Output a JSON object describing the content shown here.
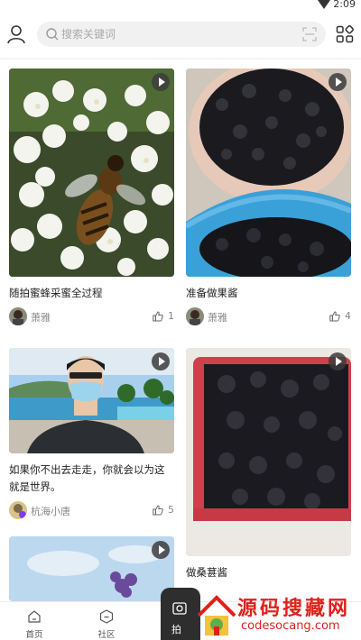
{
  "status": {
    "time": "2:09"
  },
  "header": {
    "search_placeholder": "搜索关键词",
    "user_icon": "user-icon",
    "scan_icon": "scan-icon",
    "grid_icon": "grid-icon"
  },
  "feed": {
    "cards": [
      {
        "title": "随拍蜜蜂采蜜全过程",
        "author": "萧雅",
        "likes": "1"
      },
      {
        "title": "准备做果酱",
        "author": "萧雅",
        "likes": "4"
      },
      {
        "title": "如果你不出去走走，你就会以为这就是世界。",
        "author": "杭海小唐",
        "likes": "5"
      },
      {
        "title": "做桑葚酱",
        "author": "",
        "likes": ""
      },
      {
        "title": "",
        "author": "",
        "likes": ""
      }
    ]
  },
  "bottom_nav": {
    "home": "首页",
    "community": "社区",
    "capture": "拍"
  },
  "watermark": {
    "text": "源码搜藏网",
    "url": "codesocang.com"
  },
  "colors": {
    "accent_dark": "#2e2e2e",
    "watermark_red": "#e0201a",
    "search_bg": "#f1f1f1"
  }
}
